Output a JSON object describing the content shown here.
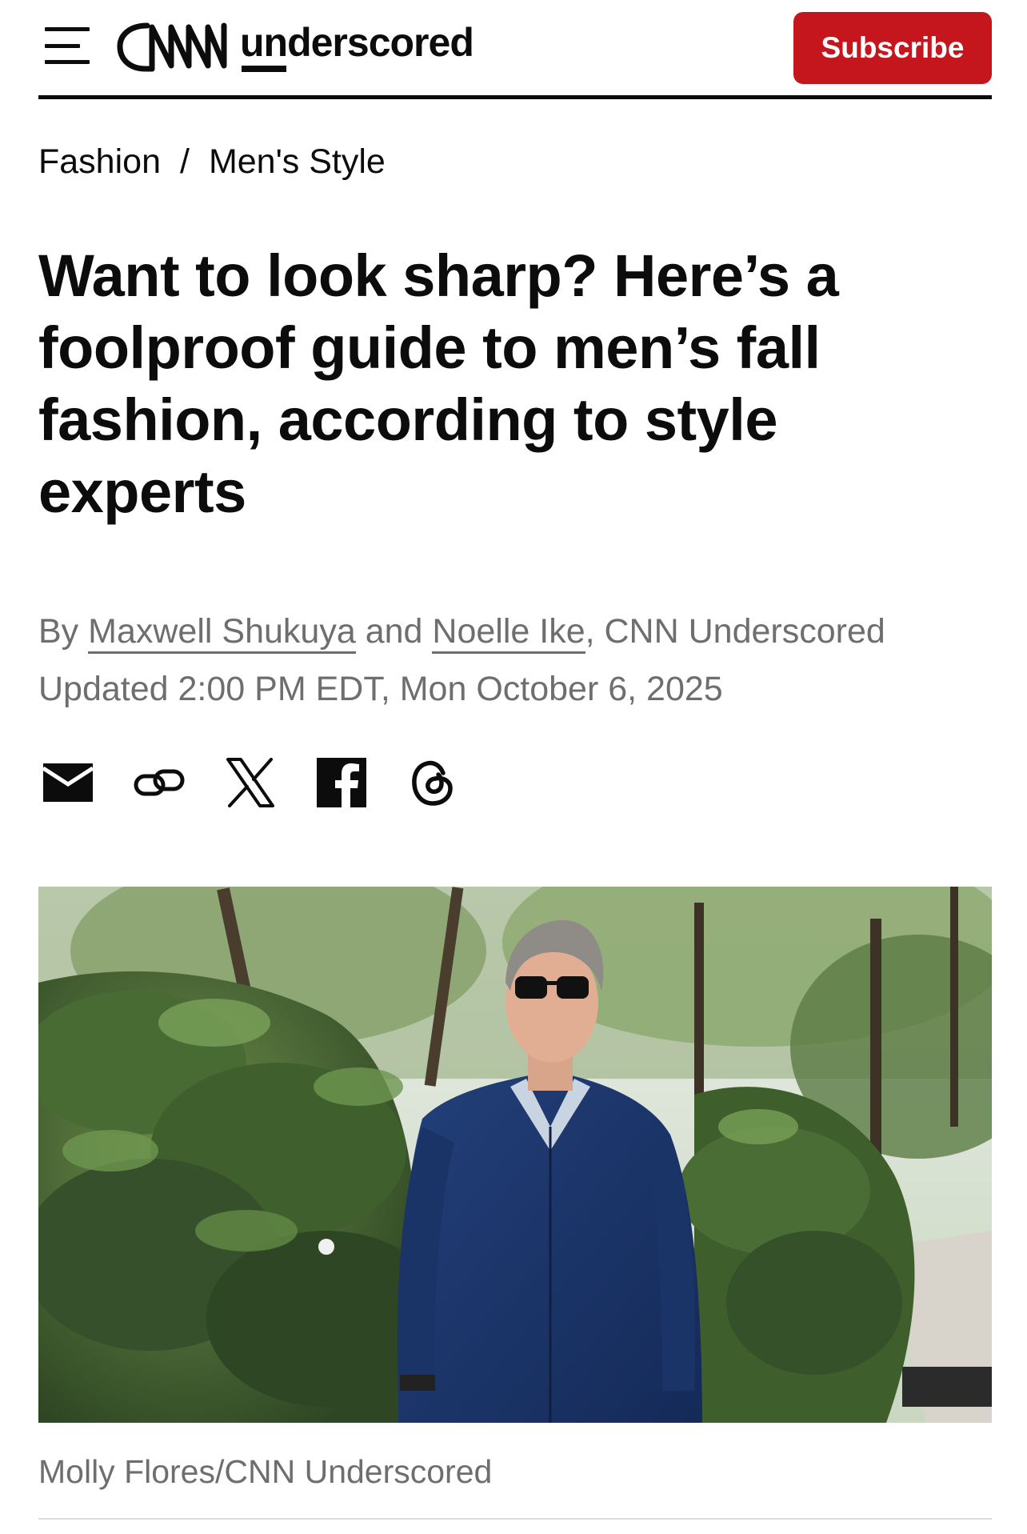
{
  "header": {
    "menu_icon": "hamburger-menu-icon",
    "logo_brand": "CNN",
    "logo_text": "underscored",
    "subscribe_label": "Subscribe",
    "accent_color": "#c4161c"
  },
  "breadcrumb": {
    "items": [
      "Fashion",
      "Men's Style"
    ],
    "separator": "/"
  },
  "article": {
    "headline": "Want to look sharp? Here’s a foolproof guide to men’s fall fashion, according to style experts",
    "byline_prefix": "By",
    "author_1": "Maxwell Shukuya",
    "byline_and": "and",
    "author_2": "Noelle Ike",
    "byline_suffix": ", CNN Underscored",
    "updated": "Updated 2:00 PM EDT, Mon October 6, 2025"
  },
  "share": {
    "icons": [
      "email-icon",
      "copy-link-icon",
      "x-icon",
      "facebook-icon",
      "threads-icon"
    ]
  },
  "hero_image": {
    "caption": "Molly Flores/CNN Underscored"
  }
}
